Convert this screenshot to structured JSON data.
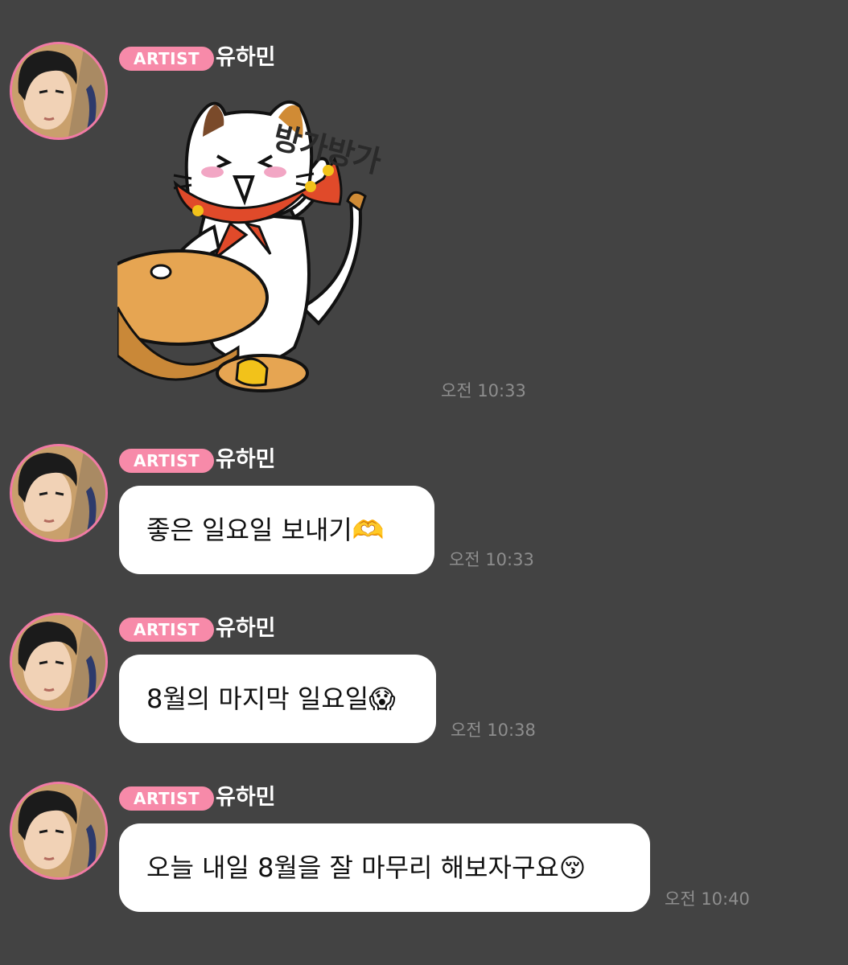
{
  "sender": {
    "badge": "ARTIST",
    "name": "유하민"
  },
  "messages": [
    {
      "type": "sticker",
      "sticker_text": "방가방가",
      "time": "오전 10:33"
    },
    {
      "type": "text",
      "text": "좋은 일요일 보내기🫶",
      "time": "오전 10:33"
    },
    {
      "type": "text",
      "text": "8월의 마지막 일요일😱",
      "time": "오전 10:38"
    },
    {
      "type": "text",
      "text": "오늘 내일 8월을 잘 마무리 해보자구요😚",
      "time": "오전 10:40"
    }
  ],
  "colors": {
    "background": "#434343",
    "badge": "#f78aa9",
    "avatar_ring": "#f07aa5",
    "bubble": "#ffffff",
    "time_text": "#8e8e8e"
  }
}
